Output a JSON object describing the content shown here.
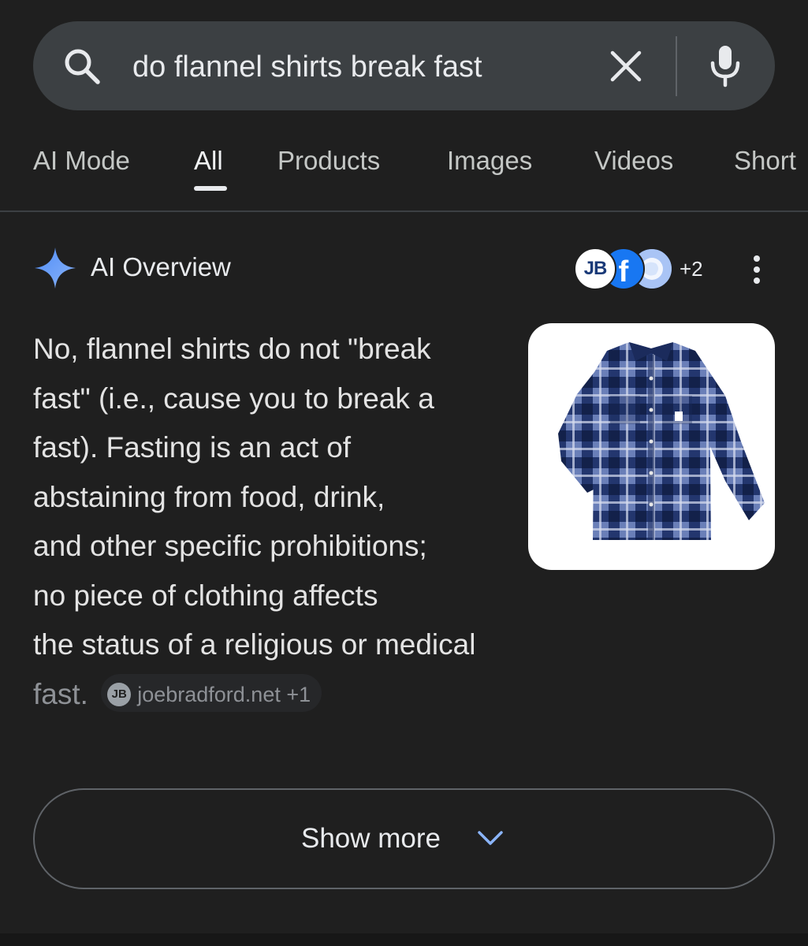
{
  "search": {
    "query": "do flannel shirts break fast",
    "search_icon": "search-icon",
    "clear_icon": "close-icon",
    "mic_icon": "microphone-icon"
  },
  "tabs": [
    {
      "label": "AI Mode",
      "active": false
    },
    {
      "label": "All",
      "active": true
    },
    {
      "label": "Products",
      "active": false
    },
    {
      "label": "Images",
      "active": false
    },
    {
      "label": "Videos",
      "active": false
    },
    {
      "label": "Short",
      "active": false
    }
  ],
  "overview": {
    "title": "AI Overview",
    "sources_more": "+2",
    "source_avatars": [
      "JB",
      "f",
      "globe"
    ],
    "lines": [
      "No, flannel shirts do not \"break",
      "fast\" (i.e., cause you to break a",
      "fast). Fasting is an act of",
      "abstaining from food, drink,",
      "and other specific prohibitions;",
      "no piece of clothing affects",
      "the status of a religious or medical",
      "fast."
    ],
    "citation": {
      "icon_text": "JB",
      "label": "joebradford.net +1"
    },
    "image_alt": "flannel-shirt-image"
  },
  "show_more": {
    "label": "Show more"
  },
  "colors": {
    "background": "#1f1f1f",
    "search_bg": "#3c4043",
    "accent_blue": "#8ab4f8",
    "text": "#e3e3e3",
    "muted": "#8e9196"
  }
}
